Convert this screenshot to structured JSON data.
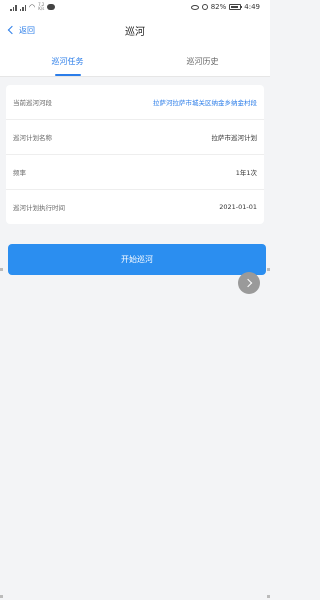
{
  "status_bar": {
    "network_speed_top": "7.2",
    "network_speed_unit": "K/s",
    "battery": "82%",
    "time": "4:49"
  },
  "nav": {
    "back_label": "返回",
    "title": "巡河"
  },
  "tabs": [
    {
      "label": "巡河任务",
      "active": true
    },
    {
      "label": "巡河历史",
      "active": false
    }
  ],
  "details": {
    "current_river": {
      "label": "当前巡河河段",
      "value": "拉萨河拉萨市城关区纳金乡纳金村段"
    },
    "plan_name": {
      "label": "巡河计划名称",
      "value": "拉萨市巡河计划"
    },
    "frequency": {
      "label": "频率",
      "value": "1年1次"
    },
    "plan_time": {
      "label": "巡河计划执行时间",
      "value": "2021-01-01"
    }
  },
  "start_button_label": "开始巡河",
  "colors": {
    "accent": "#2b7de9",
    "button": "#2b8ef0",
    "background": "#f3f4f6",
    "float_button": "#9a9a9a"
  },
  "icons": {
    "back": "chevron-left-icon",
    "float": "chevron-right-icon"
  }
}
